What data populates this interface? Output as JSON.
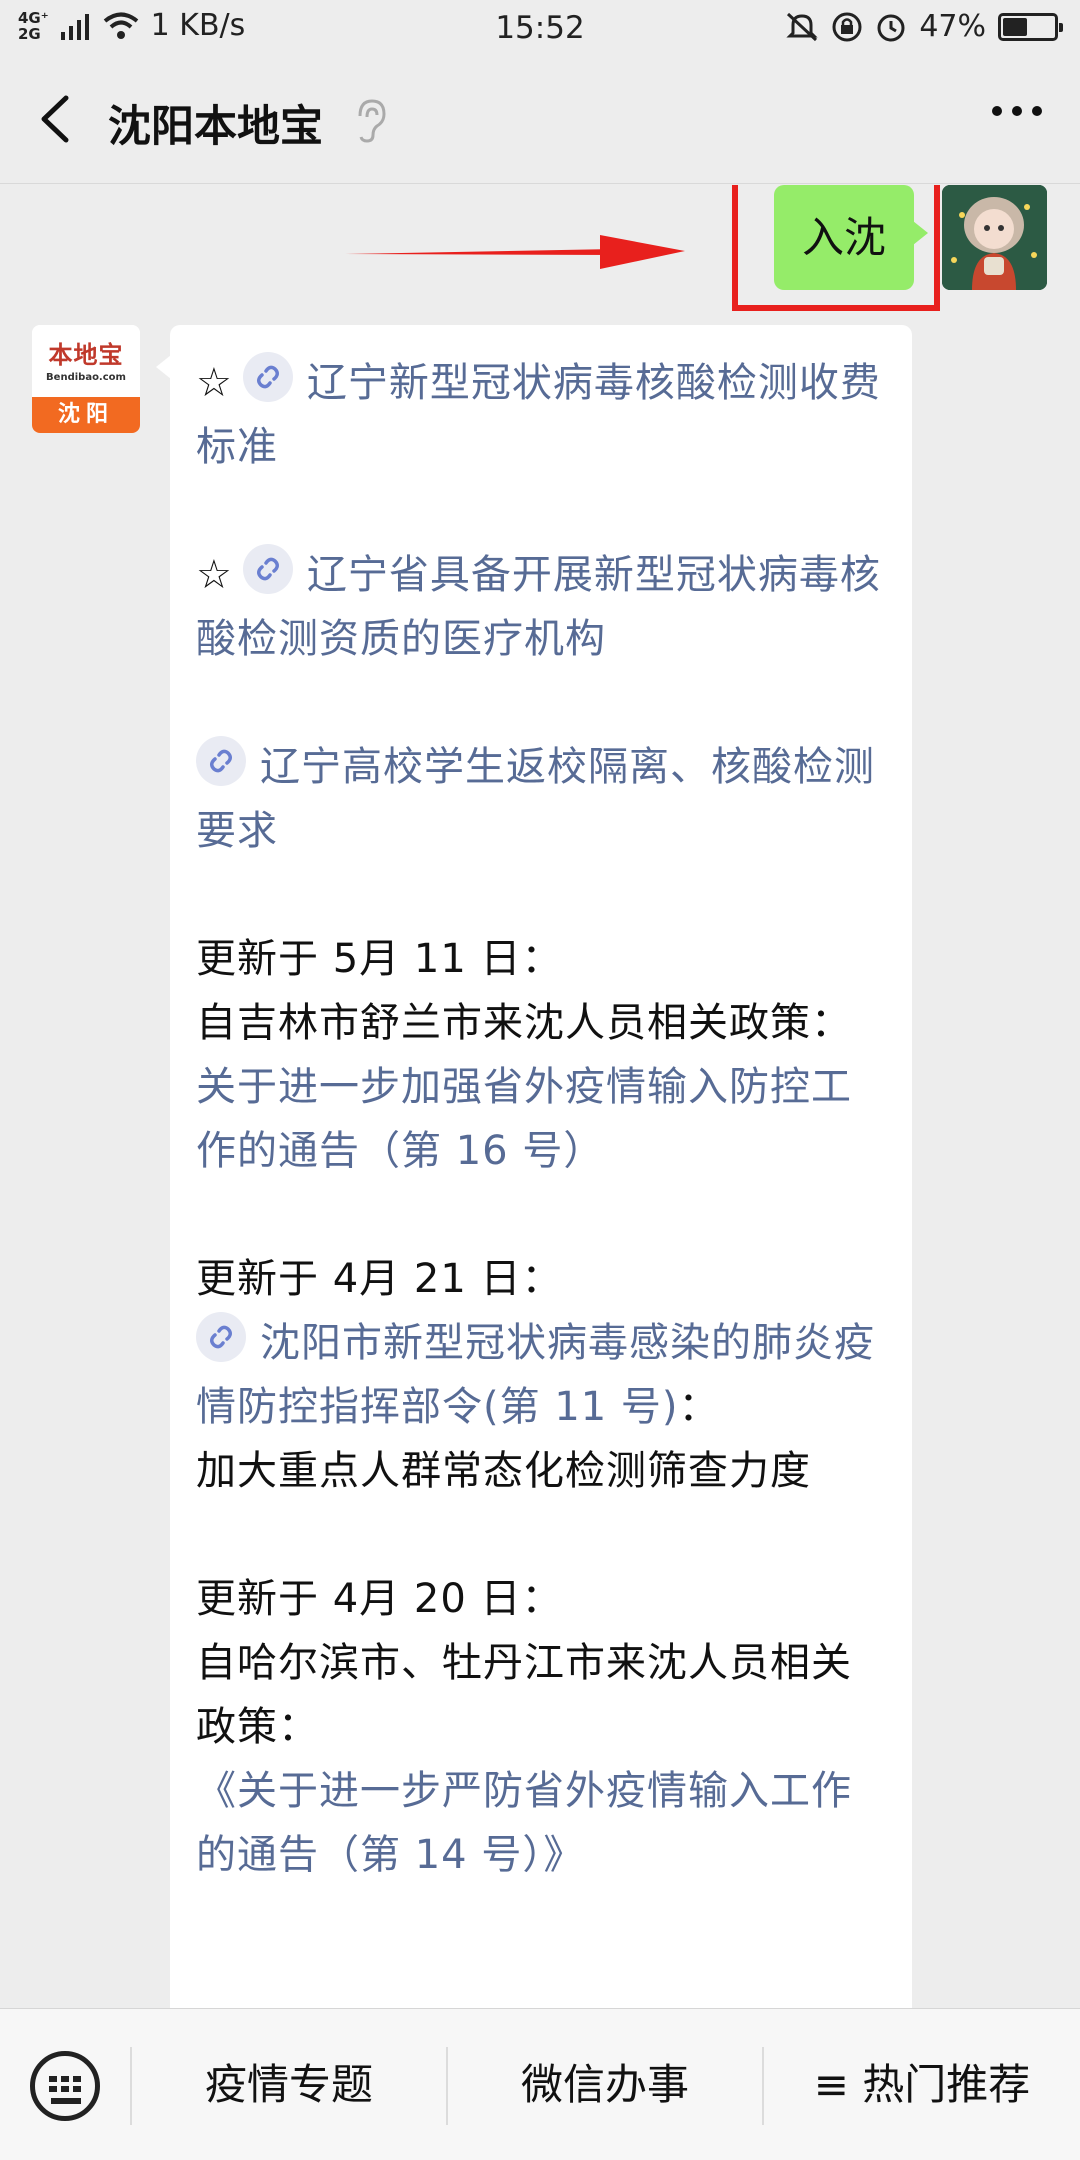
{
  "status_bar": {
    "network_top": "4G⁺",
    "network_bottom": "2G",
    "speed": "1 KB/s",
    "time": "15:52",
    "battery_percent": "47%",
    "battery_level": 0.47
  },
  "nav": {
    "title": "沈阳本地宝",
    "back_icon": "chevron-left-icon",
    "ear_icon": "ear-icon",
    "more_icon": "more-dots-icon"
  },
  "chat": {
    "my_message": "入沈",
    "account_avatar": {
      "logo_text": "本地宝",
      "logo_sub": "Bendibao.com",
      "city": "沈阳"
    },
    "reply": {
      "p1_link": "辽宁新型冠状病毒核酸检测收费标准",
      "p2_link": "辽宁省具备开展新型冠状病毒核酸检测资质的医疗机构",
      "p3_link": "辽宁高校学生返校隔离、核酸检测要求",
      "p4_head": "更新于 5月 11 日：",
      "p4_text": "自吉林市舒兰市来沈人员相关政策：",
      "p4_link": "关于进一步加强省外疫情输入防控工作的通告（第 16 号）",
      "p5_head": "更新于 4月 21 日：",
      "p5_link": "沈阳市新型冠状病毒感染的肺炎疫情防控指挥部令(第 11 号)",
      "p5_colon": "：",
      "p5_text": "加大重点人群常态化检测筛查力度",
      "p6_head": "更新于 4月 20 日：",
      "p6_text": "自哈尔滨市、牡丹江市来沈人员相关政策：",
      "p6_link": "《关于进一步严防省外疫情输入工作的通告（第 14 号）》",
      "star": "☆"
    }
  },
  "bottom_menu": {
    "keyboard_icon": "keyboard-icon",
    "items": [
      {
        "label": "疫情专题"
      },
      {
        "label": "微信办事"
      },
      {
        "label": "≡ 热门推荐"
      }
    ]
  },
  "colors": {
    "link": "#576b95",
    "my_bubble": "#95ec69",
    "annotation": "#e8201d",
    "background": "#ededed"
  }
}
